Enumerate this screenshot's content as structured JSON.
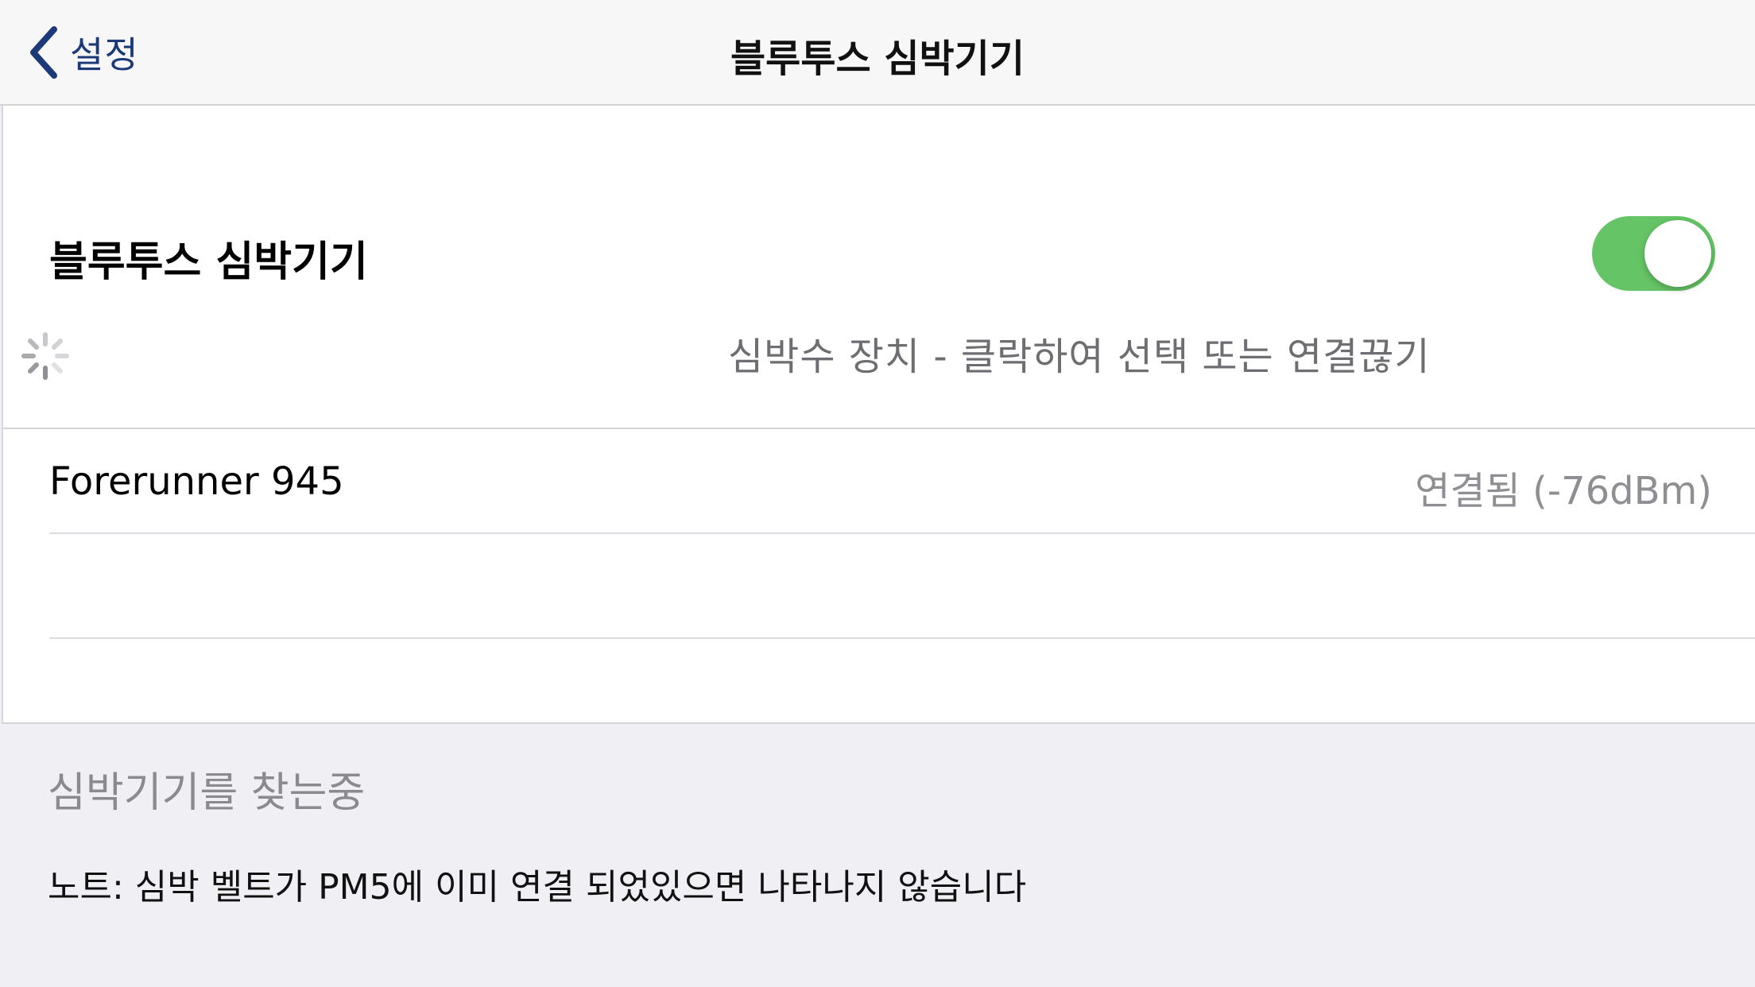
{
  "navbar": {
    "back_label": "설정",
    "title": "블루투스 심박기기"
  },
  "section": {
    "title": "블루투스 심박기기",
    "toggle_on": true,
    "scan_hint": "심박수 장치 - 클락하여 선택 또는 연결끊기"
  },
  "devices": [
    {
      "name": "Forerunner 945",
      "status": "연결됨 (-76dBm)"
    }
  ],
  "footer": {
    "searching": "심박기기를 찾는중",
    "note": "노트: 심박 벨트가 PM5에 이미 연결 되었있으면 나타나지 않습니다"
  },
  "colors": {
    "toggle_on": "#65c466",
    "back_tint": "#1d3a78",
    "secondary_text": "#8e8e93",
    "background": "#efeff4"
  },
  "icons": {
    "back": "chevron-left-icon",
    "spinner": "activity-spinner-icon"
  }
}
